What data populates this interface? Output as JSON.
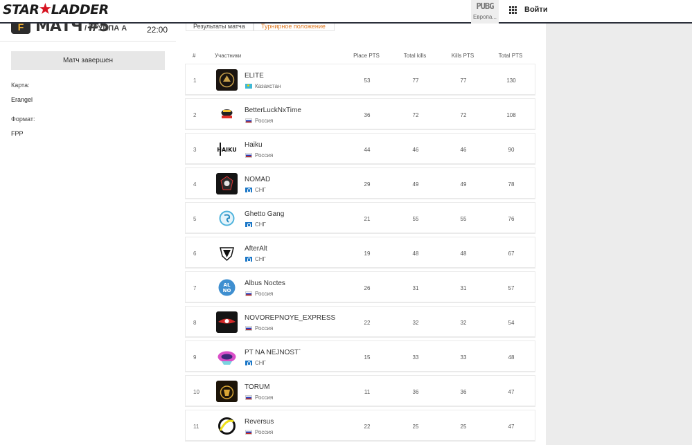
{
  "header": {
    "logo_left": "STAR",
    "logo_star": "★",
    "logo_right": "LADDER",
    "game": "PUBG",
    "region": "Европа...",
    "login": "Войти"
  },
  "match": {
    "badge": "F",
    "title": "МАТЧ #5",
    "group": "/ ГРУППА А",
    "time": "22:00",
    "status": "Матч завершен",
    "map_label": "Карта:",
    "map_value": "Erangel",
    "format_label": "Формат:",
    "format_value": "FPP"
  },
  "tabs": {
    "results": "Результаты матча",
    "standings": "Турнирное положение"
  },
  "table": {
    "headers": {
      "num": "#",
      "participants": "Участники",
      "place": "Place PTS",
      "total_kills": "Total kills",
      "kills_pts": "Kills PTS",
      "total": "Total PTS"
    },
    "rows": [
      {
        "num": "1",
        "name": "ELITE",
        "country": "Казахстан",
        "flag": "kz",
        "logo": "elite-logo",
        "place": "53",
        "total_kills": "77",
        "kills_pts": "77",
        "total": "130"
      },
      {
        "num": "2",
        "name": "BetterLuckNxTime",
        "country": "Россия",
        "flag": "ru",
        "logo": "betterluck-logo",
        "place": "36",
        "total_kills": "72",
        "kills_pts": "72",
        "total": "108"
      },
      {
        "num": "3",
        "name": "Haiku",
        "country": "Россия",
        "flag": "ru",
        "logo": "haiku-logo",
        "place": "44",
        "total_kills": "46",
        "kills_pts": "46",
        "total": "90"
      },
      {
        "num": "4",
        "name": "NOMAD",
        "country": "СНГ",
        "flag": "cis",
        "logo": "nomad-logo",
        "place": "29",
        "total_kills": "49",
        "kills_pts": "49",
        "total": "78"
      },
      {
        "num": "5",
        "name": "Ghetto Gang",
        "country": "СНГ",
        "flag": "cis",
        "logo": "ghetto-gang-logo",
        "place": "21",
        "total_kills": "55",
        "kills_pts": "55",
        "total": "76"
      },
      {
        "num": "6",
        "name": "AfterAlt",
        "country": "СНГ",
        "flag": "cis",
        "logo": "afteralt-logo",
        "place": "19",
        "total_kills": "48",
        "kills_pts": "48",
        "total": "67"
      },
      {
        "num": "7",
        "name": "Albus Noctes",
        "country": "Россия",
        "flag": "ru",
        "logo": "albus-noctes-logo",
        "place": "26",
        "total_kills": "31",
        "kills_pts": "31",
        "total": "57"
      },
      {
        "num": "8",
        "name": "NOVOREPNOYE_EXPRESS",
        "country": "Россия",
        "flag": "ru",
        "logo": "novorepnoye-logo",
        "place": "22",
        "total_kills": "32",
        "kills_pts": "32",
        "total": "54"
      },
      {
        "num": "9",
        "name": "PT NA NEJNOSТ`",
        "country": "СНГ",
        "flag": "cis",
        "logo": "pt-na-nejnost-logo",
        "place": "15",
        "total_kills": "33",
        "kills_pts": "33",
        "total": "48"
      },
      {
        "num": "10",
        "name": "TORUM",
        "country": "Россия",
        "flag": "ru",
        "logo": "torum-logo",
        "place": "11",
        "total_kills": "36",
        "kills_pts": "36",
        "total": "47"
      },
      {
        "num": "11",
        "name": "Reversus",
        "country": "Россия",
        "flag": "ru",
        "logo": "reversus-logo",
        "place": "22",
        "total_kills": "25",
        "kills_pts": "25",
        "total": "47"
      }
    ]
  },
  "colors": {
    "accent": "#e07b23",
    "brand_red": "#d52b1e",
    "header_border": "#2b2f3a"
  }
}
